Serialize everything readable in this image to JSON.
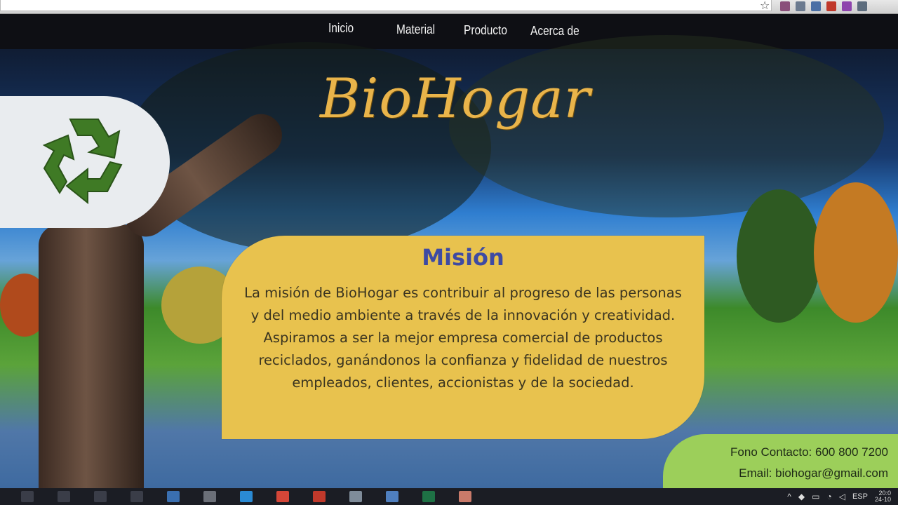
{
  "nav": {
    "items": [
      {
        "label": "Inicio"
      },
      {
        "label": "Material"
      },
      {
        "label": "Producto"
      },
      {
        "label": "Acerca de"
      }
    ]
  },
  "brand": {
    "title": "BioHogar",
    "logo_icon": "recycle-icon",
    "logo_color": "#3f7a25",
    "title_color": "#e9b44a"
  },
  "mission": {
    "title": "Misión",
    "text": "La misión de BioHogar es contribuir al progreso de las personas y del medio ambiente a través de la innovación y creatividad. Aspiramos a ser la mejor empresa comercial de productos reciclados, ganándonos la confianza y fidelidad de nuestros empleados, clientes, accionistas y de la sociedad.",
    "card_color": "#e8c24e",
    "title_color": "#3e4aa3"
  },
  "contact": {
    "phone": "Fono Contacto: 600 800 7200",
    "email": "Email: biohogar@gmail.com",
    "card_color": "#9ccf5a"
  },
  "taskbar": {
    "language": "ESP",
    "time": "20:0",
    "date": "24-10"
  }
}
